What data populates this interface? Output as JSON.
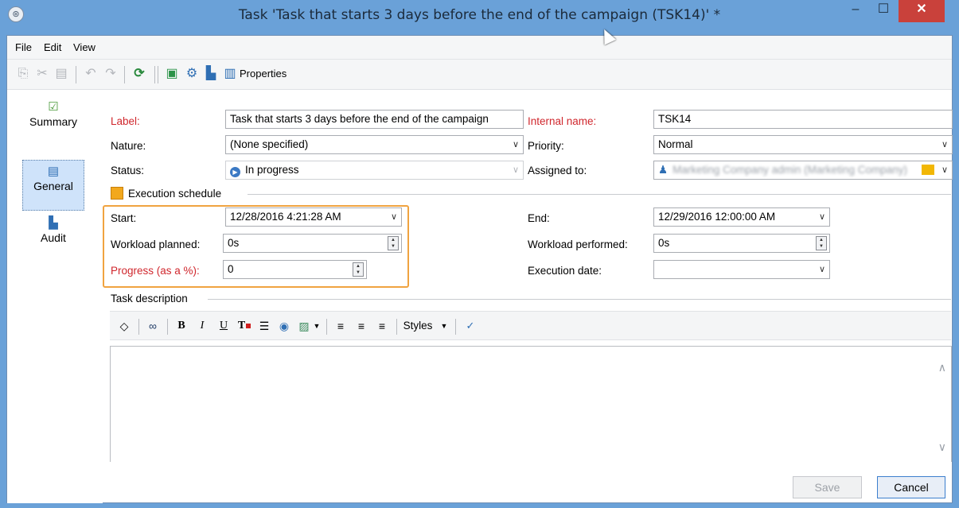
{
  "window": {
    "title": "Task 'Task that starts 3 days before the end of the campaign (TSK14)' *",
    "min_label": "–",
    "max_label": "☐",
    "close_label": "✕"
  },
  "menu": {
    "items": [
      "File",
      "Edit",
      "View"
    ]
  },
  "toolbar": {
    "properties_label": "Properties"
  },
  "sidebar": {
    "items": [
      {
        "label": "Summary",
        "icon": "check-icon"
      },
      {
        "label": "General",
        "icon": "clipboard-icon"
      },
      {
        "label": "Audit",
        "icon": "audit-icon"
      }
    ],
    "active": "General"
  },
  "form": {
    "label_label": "Label:",
    "label_value": "Task that starts 3 days before the end of the campaign",
    "internal_name_label": "Internal name:",
    "internal_name_value": "TSK14",
    "nature_label": "Nature:",
    "nature_value": "(None specified)",
    "priority_label": "Priority:",
    "priority_value": "Normal",
    "status_label": "Status:",
    "status_value": "In progress",
    "assigned_label": "Assigned to:",
    "assigned_value": "Marketing Company admin (Marketing Company)"
  },
  "schedule": {
    "group_label": "Execution schedule",
    "start_label": "Start:",
    "start_value": "12/28/2016 4:21:28 AM",
    "end_label": "End:",
    "end_value": "12/29/2016 12:00:00 AM",
    "workload_planned_label": "Workload planned:",
    "workload_planned_value": "0s",
    "workload_performed_label": "Workload performed:",
    "workload_performed_value": "0s",
    "progress_label": "Progress (as a %):",
    "progress_value": "0",
    "execution_date_label": "Execution date:",
    "execution_date_value": ""
  },
  "description": {
    "group_label": "Task description",
    "styles_label": "Styles"
  },
  "buttons": {
    "save": "Save",
    "cancel": "Cancel"
  },
  "colors": {
    "required_label": "#d0272d",
    "highlight_border": "#f0a340",
    "titlebar": "#6aa1d8",
    "close_button": "#c9413b"
  }
}
